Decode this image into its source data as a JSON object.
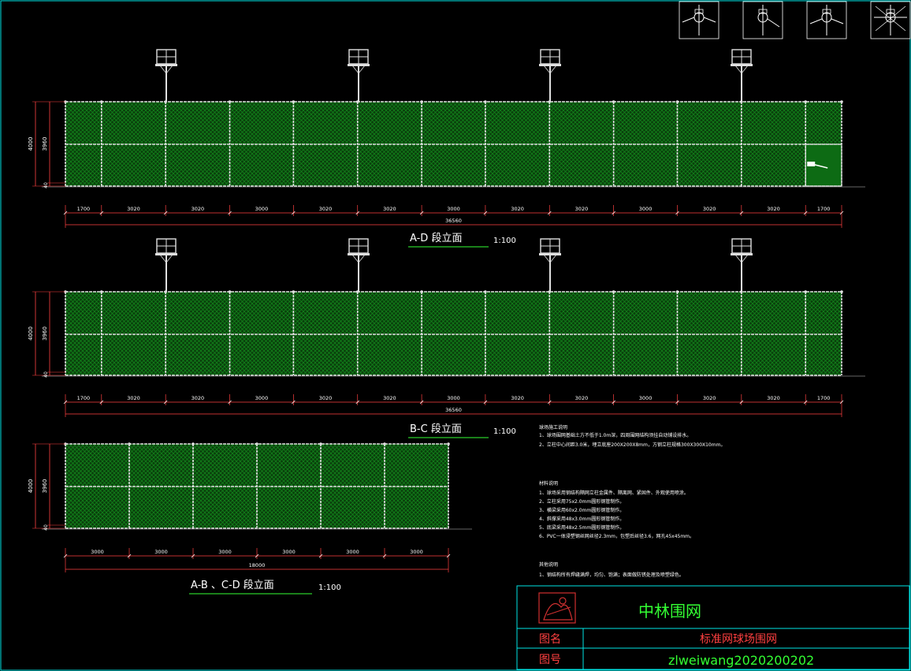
{
  "theme": {
    "background": "#000000",
    "frame": "#00e5e5",
    "mesh": "#0b5e12",
    "post": "#e0e0e0",
    "dim": "#ff4040",
    "title_green": "#33ff33",
    "text_white": "#ffffff",
    "logo_red": "#d03030"
  },
  "details": [
    {
      "label": "",
      "icon": "post-clamp-detail-icon"
    },
    {
      "label": "",
      "icon": "corner-clamp-detail-icon"
    },
    {
      "label": "",
      "icon": "tee-clamp-detail-icon"
    },
    {
      "label": "",
      "icon": "cross-clamp-detail-icon"
    }
  ],
  "elevations": [
    {
      "id": "ad",
      "title": "A-D 段立面",
      "scale": "1:100",
      "height_total": "4000",
      "height_mesh": "3960",
      "base": "40",
      "segments": [
        "1700",
        "3020",
        "3020",
        "3000",
        "3020",
        "3020",
        "3000",
        "3020",
        "3020",
        "3000",
        "3020",
        "3020",
        "1700"
      ],
      "total": "36560",
      "lights": 4,
      "gate": true
    },
    {
      "id": "bc",
      "title": "B-C 段立面",
      "scale": "1:100",
      "height_total": "4000",
      "height_mesh": "3960",
      "base": "40",
      "segments": [
        "1700",
        "3020",
        "3020",
        "3000",
        "3020",
        "3020",
        "3000",
        "3020",
        "3020",
        "3000",
        "3020",
        "3020",
        "1700"
      ],
      "total": "36560",
      "lights": 4,
      "gate": false
    },
    {
      "id": "ab",
      "title": "A-B 、C-D 段立面",
      "scale": "1:100",
      "height_total": "4000",
      "height_mesh": "3960",
      "base": "40",
      "segments": [
        "3000",
        "3000",
        "3000",
        "3000",
        "3000",
        "3000"
      ],
      "total": "18000",
      "lights": 0,
      "gate": false
    }
  ],
  "notes": {
    "construction": {
      "heading": "球场施工说明",
      "items": [
        "1、球场围网基础土方不低于1.0m深，四周围网结构须挂自动铺设排水。",
        "2、立柱中心间距3.0米，埋立底座200X200X8mm，方钢立柱规格300X300X10mm。"
      ]
    },
    "materials": {
      "heading": "材料说明",
      "items": [
        "1、球场采用钢结构隔网立柱金属件、隔离网、紧固件、外观使用喷涂。",
        "2、立柱采用75x2.0mm圆形钢管制作。",
        "3、横梁采用60x2.0mm圆形钢管制作。",
        "4、斜撑采用48x3.0mm圆形钢管制作。",
        "5、底梁采用48x2.5mm圆形钢管制作。",
        "6、PVC一体浸塑钢丝网丝径2.3mm，包塑后丝径3.6，网孔45x45mm。"
      ]
    },
    "other": {
      "heading": "其他说明",
      "items": [
        "1、钢结构所有焊缝满焊，均匀、饱满；表面做防锈处理及喷塑绿色。"
      ]
    }
  },
  "title_block": {
    "company": "中林围网",
    "name_label": "图名",
    "name_value": "标准网球场围网",
    "number_label": "图号",
    "number_value": "zlweiwang2020200202"
  }
}
